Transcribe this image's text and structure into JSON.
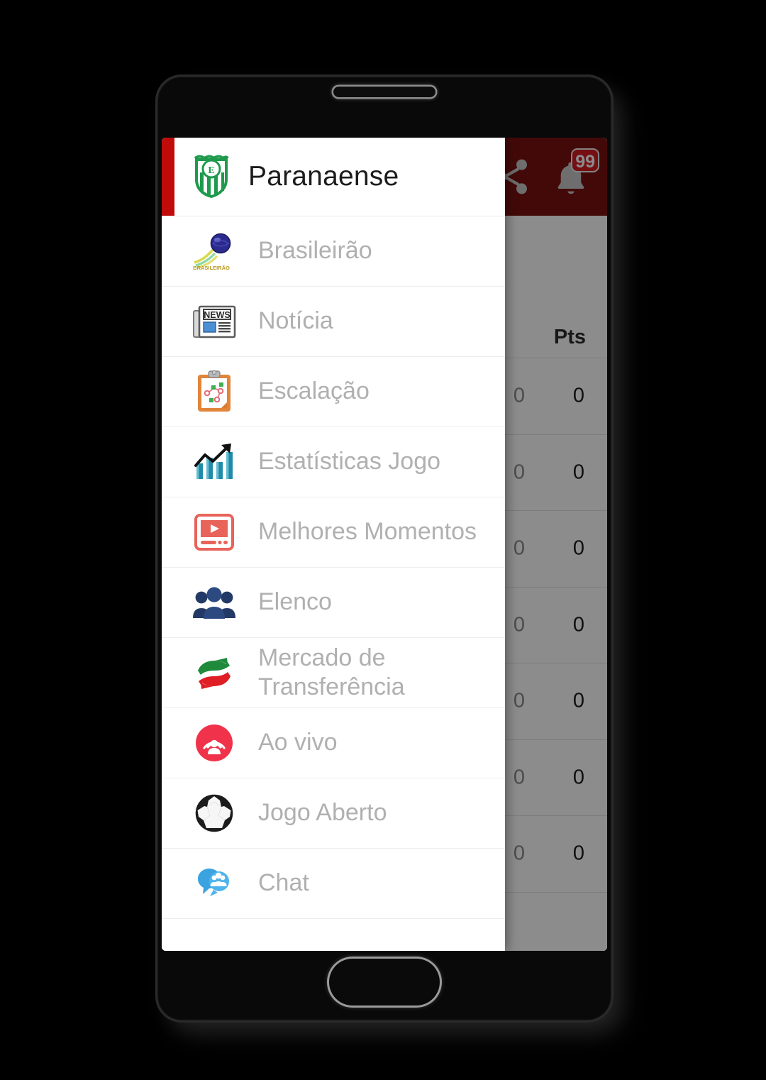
{
  "device": {
    "earpiece": "earpiece-speaker",
    "home_button": "home-button"
  },
  "app": {
    "toolbar": {
      "background_color": "#7b1212",
      "share_icon": "share-icon",
      "bell_icon": "bell-icon",
      "notification_badge": "99"
    },
    "standings": {
      "columns": [
        "Pts"
      ],
      "header_pts": "Pts",
      "rows": [
        {
          "gd": "0",
          "pts": "0"
        },
        {
          "gd": "0",
          "pts": "0"
        },
        {
          "gd": "0",
          "pts": "0"
        },
        {
          "gd": "0",
          "pts": "0"
        },
        {
          "gd": "0",
          "pts": "0"
        },
        {
          "gd": "0",
          "pts": "0"
        },
        {
          "gd": "0",
          "pts": "0"
        }
      ]
    }
  },
  "drawer": {
    "header": {
      "club_name": "Paranaense",
      "crest_icon": "club-crest-icon",
      "accent_color": "#c00b0b"
    },
    "items": [
      {
        "label": "Brasileirão",
        "icon": "brasileirao-logo-icon"
      },
      {
        "label": "Notícia",
        "icon": "newspaper-icon"
      },
      {
        "label": "Escalação",
        "icon": "clipboard-tactics-icon"
      },
      {
        "label": "Estatísticas Jogo",
        "icon": "bar-chart-trend-icon"
      },
      {
        "label": "Melhores Momentos",
        "icon": "video-player-icon"
      },
      {
        "label": "Elenco",
        "icon": "people-group-icon"
      },
      {
        "label": "Mercado de Transferência",
        "icon": "transfer-arrows-icon"
      },
      {
        "label": "Ao vivo",
        "icon": "live-broadcast-icon"
      },
      {
        "label": "Jogo Aberto",
        "icon": "soccer-ball-icon"
      },
      {
        "label": "Chat",
        "icon": "chat-bubble-people-icon"
      }
    ]
  }
}
